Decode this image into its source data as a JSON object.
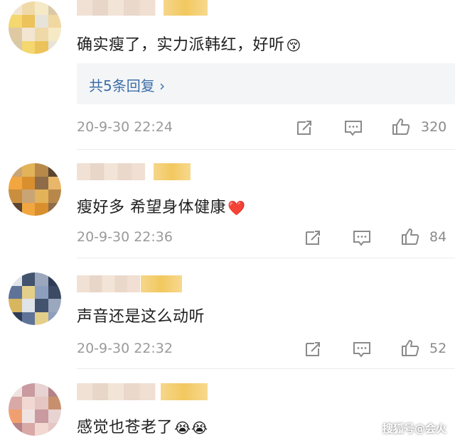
{
  "comments": [
    {
      "text": "确实瘦了，实力派韩红，好听",
      "emoji": "😚",
      "replies_label": "共5条回复 ›",
      "timestamp": "20-9-30 22:24",
      "likes": "320",
      "avatar_colors": [
        "#f2e5d2",
        "#efd9a8",
        "#f6e9c6",
        "#d9c9a7",
        "#f4d76e",
        "#ecc35a",
        "#e6e3d8",
        "#f1d8a0",
        "#dfc9a3"
      ]
    },
    {
      "text": "瘦好多 希望身体健康",
      "emoji": "❤️",
      "timestamp": "20-9-30 22:36",
      "likes": "84",
      "avatar_colors": [
        "#c9a576",
        "#e3b35a",
        "#b8884a",
        "#5b4530",
        "#f2a640",
        "#d98f2e",
        "#8e6c48",
        "#e8b76a",
        "#c98f3f"
      ]
    },
    {
      "text": "声音还是这么动听",
      "timestamp": "20-9-30 22:32",
      "likes": "52",
      "avatar_colors": [
        "#dfe3ea",
        "#43536e",
        "#9aa7bd",
        "#2e3c56",
        "#5f7398",
        "#e4cf8a",
        "#8d9fbf",
        "#3c4a63",
        "#d8b65e"
      ]
    },
    {
      "text": "感觉也苍老了",
      "emoji": "😭😭",
      "avatar_colors": [
        "#efe3e2",
        "#c99aa0",
        "#e8d3d3",
        "#b48287",
        "#d8a9a6",
        "#f1d8d1",
        "#e6c6c3",
        "#c88f6e",
        "#f0a070"
      ]
    }
  ],
  "watermark": "搜狐号@会火"
}
